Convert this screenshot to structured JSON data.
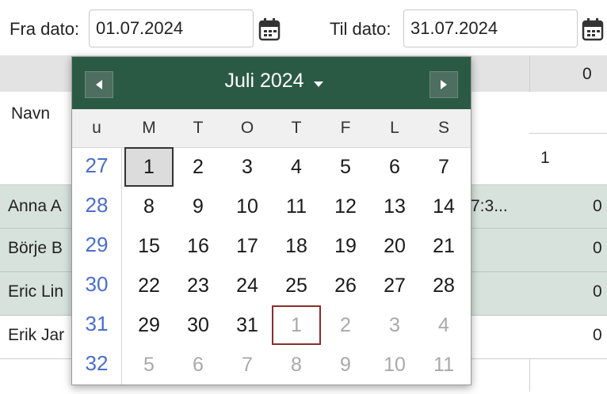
{
  "filters": {
    "from_label": "Fra dato:",
    "from_value": "01.07.2024",
    "to_label": "Til dato:",
    "to_value": "31.07.2024",
    "calendar_icon": "calendar-icon"
  },
  "table": {
    "header_col_right": "0",
    "name_header": "Navn",
    "sub_header_right": "1",
    "rows": [
      {
        "name": "Anna A",
        "mid": "7:3...",
        "right": "0"
      },
      {
        "name": "Börje B",
        "mid": "",
        "right": "0"
      },
      {
        "name": "Eric Lin",
        "mid": "",
        "right": "0"
      },
      {
        "name": "Erik Jar",
        "mid": "",
        "right": "0"
      }
    ]
  },
  "datepicker": {
    "month_label": "Juli 2024",
    "dropdown_icon": "caret-down-icon",
    "prev_icon": "chevron-left-icon",
    "next_icon": "chevron-right-icon",
    "week_header": "u",
    "weekdays": [
      "M",
      "T",
      "O",
      "T",
      "F",
      "L",
      "S"
    ],
    "weeks": [
      {
        "week": "27",
        "days": [
          "1",
          "2",
          "3",
          "4",
          "5",
          "6",
          "7"
        ]
      },
      {
        "week": "28",
        "days": [
          "8",
          "9",
          "10",
          "11",
          "12",
          "13",
          "14"
        ]
      },
      {
        "week": "29",
        "days": [
          "15",
          "16",
          "17",
          "18",
          "19",
          "20",
          "21"
        ]
      },
      {
        "week": "30",
        "days": [
          "22",
          "23",
          "24",
          "25",
          "26",
          "27",
          "28"
        ]
      },
      {
        "week": "31",
        "days": [
          "29",
          "30",
          "31",
          "1",
          "2",
          "3",
          "4"
        ]
      },
      {
        "week": "32",
        "days": [
          "5",
          "6",
          "7",
          "8",
          "9",
          "10",
          "11"
        ]
      }
    ],
    "selected_day": "1",
    "highlight_colors": {
      "header": "#2b5a44",
      "week_number": "#4a6ecc",
      "today_border": "#8b2c2c"
    }
  }
}
